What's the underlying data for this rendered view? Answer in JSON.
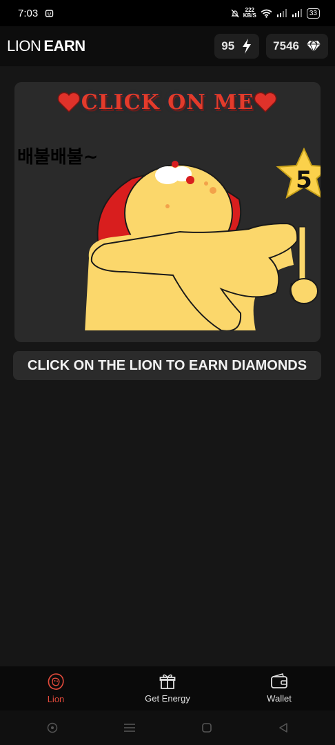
{
  "status_bar": {
    "time": "7:03",
    "speed_value": "222",
    "speed_unit": "KB/S",
    "battery": "33"
  },
  "header": {
    "brand_part1": "LION",
    "brand_part2": "EARN",
    "energy": "95",
    "diamonds": "7546"
  },
  "card": {
    "title": "CLICK ON ME",
    "sticker_text": "배불배불~",
    "star_number": "5"
  },
  "hint": "CLICK ON THE LION TO EARN DIAMONDS",
  "nav": [
    {
      "label": "Lion",
      "icon": "lion-icon",
      "active": true
    },
    {
      "label": "Get Energy",
      "icon": "gift-icon",
      "active": false
    },
    {
      "label": "Wallet",
      "icon": "wallet-icon",
      "active": false
    }
  ],
  "colors": {
    "accent": "#e24a3b",
    "background": "#161616",
    "card": "#2a2a2a"
  }
}
